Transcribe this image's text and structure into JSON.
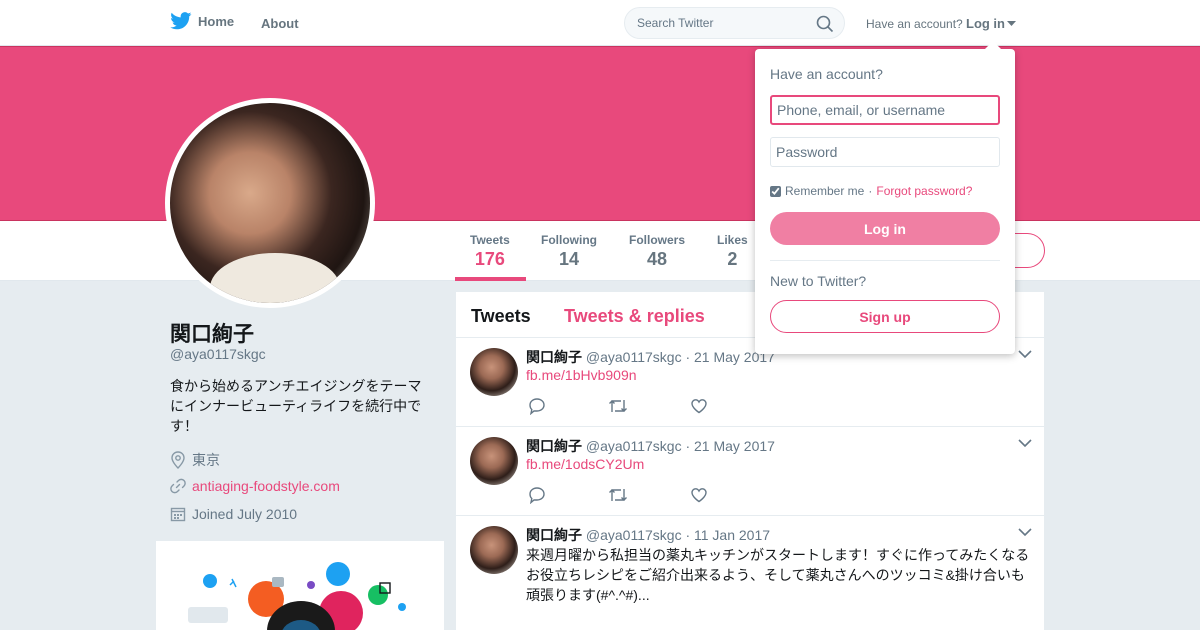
{
  "nav": {
    "home_label": "Home",
    "about_label": "About",
    "search_placeholder": "Search Twitter",
    "have_account": "Have an account?",
    "login_label": "Log in"
  },
  "colors": {
    "accent": "#e8497c",
    "banner": "#e8497c",
    "text": "#14171a",
    "muted": "#657786"
  },
  "stats": [
    {
      "label": "Tweets",
      "value": "176"
    },
    {
      "label": "Following",
      "value": "14"
    },
    {
      "label": "Followers",
      "value": "48"
    },
    {
      "label": "Likes",
      "value": "2"
    }
  ],
  "profile": {
    "name": "関口絢子",
    "handle": "@aya0117skgc",
    "bio": "食から始めるアンチエイジングをテーマにインナービューティライフを続行中です！",
    "location": "東京",
    "website": "antiaging-foodstyle.com",
    "joined": "Joined July 2010"
  },
  "timeline": {
    "tabs": [
      "Tweets",
      "Tweets & replies"
    ],
    "tweets": [
      {
        "name": "関口絢子",
        "meta": "@aya0117skgc · 21 May 2017",
        "link": "fb.me/1bHvb909n"
      },
      {
        "name": "関口絢子",
        "meta": "@aya0117skgc · 21 May 2017",
        "link": "fb.me/1odsCY2Um"
      },
      {
        "name": "関口絢子",
        "meta": "@aya0117skgc · 11 Jan 2017",
        "text": "来週月曜から私担当の薬丸キッチンがスタートします！すぐに作ってみたくなるお役立ちレシピをご紹介出来るよう、そして薬丸さんへのツッコミ&掛け合いも頑張ります(#^.^#)..."
      }
    ]
  },
  "login_dropdown": {
    "title": "Have an account?",
    "username_placeholder": "Phone, email, or username",
    "password_placeholder": "Password",
    "remember": "Remember me",
    "separator": "·",
    "forgot": "Forgot password?",
    "login_button": "Log in",
    "new_to": "New to Twitter?",
    "signup_button": "Sign up"
  }
}
